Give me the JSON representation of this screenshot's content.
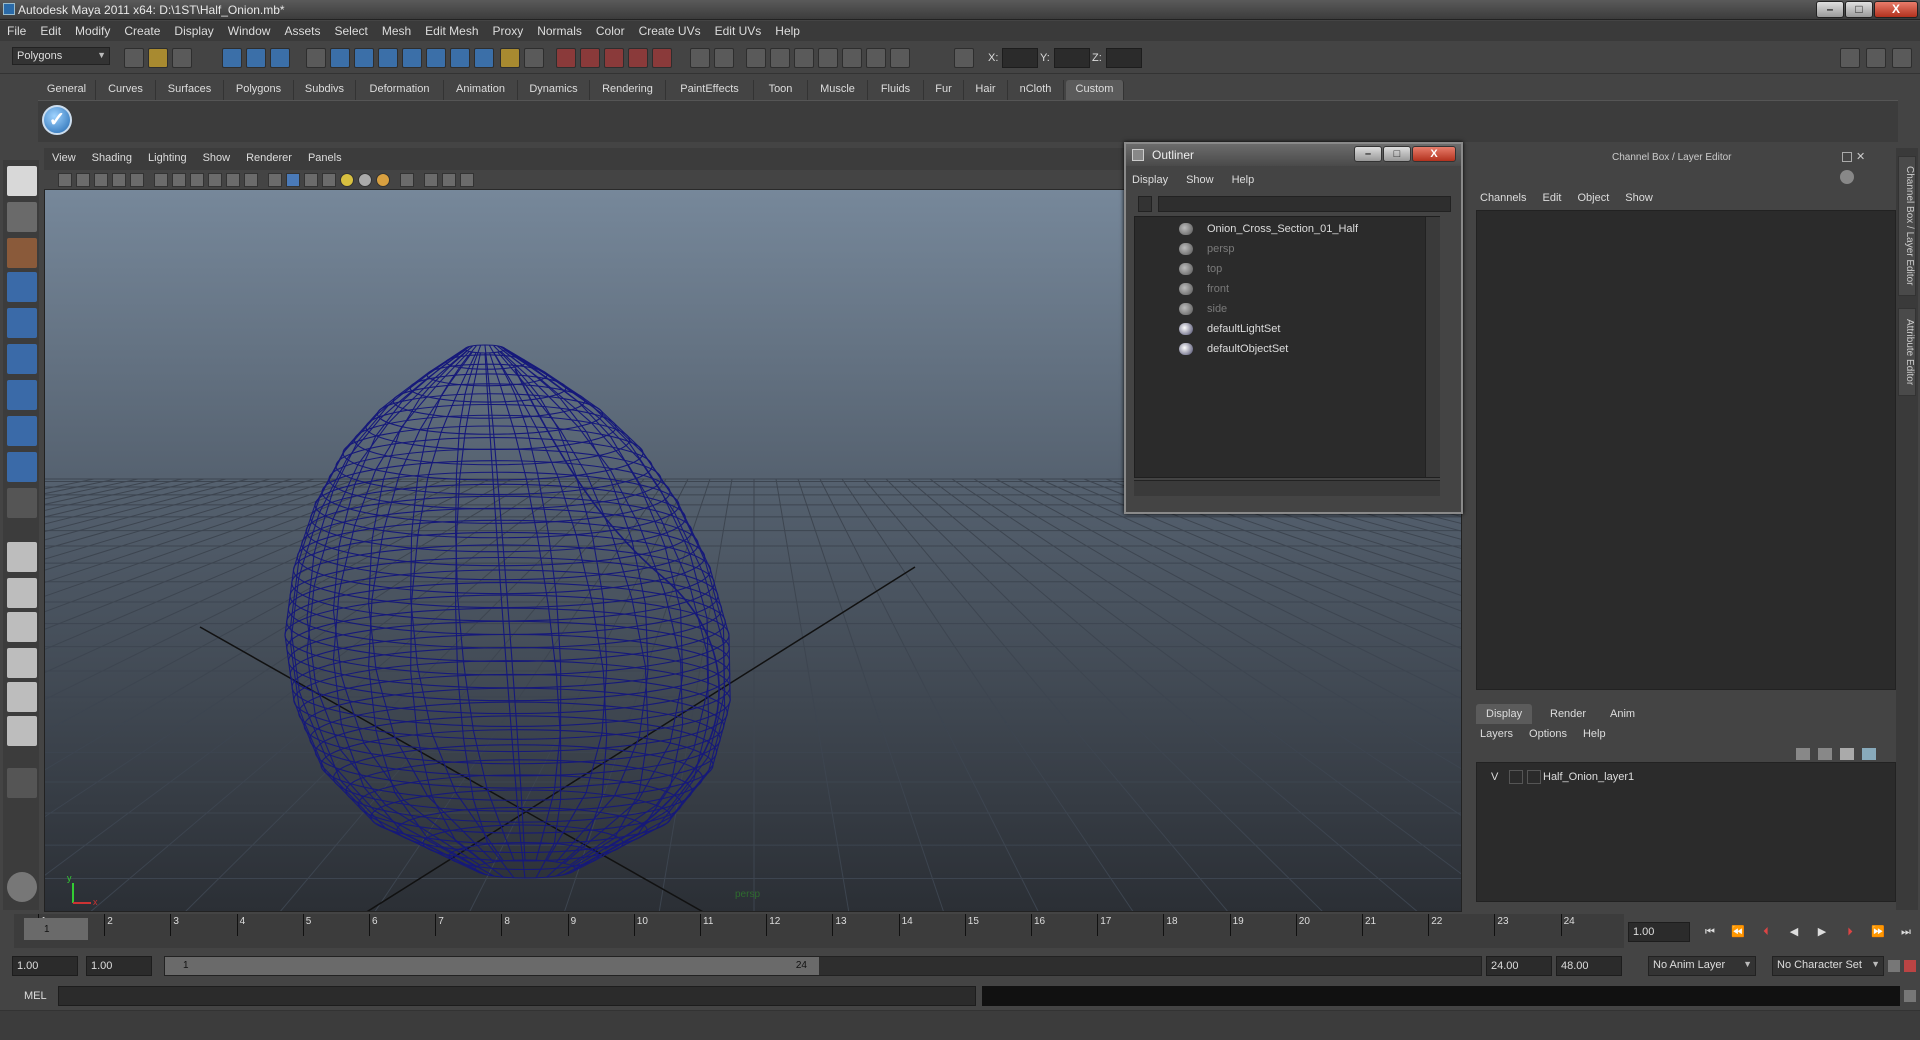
{
  "window": {
    "title": "Autodesk Maya 2011 x64: D:\\1ST\\Half_Onion.mb*",
    "minimize": "–",
    "maximize": "□",
    "close": "X"
  },
  "menubar": [
    "File",
    "Edit",
    "Modify",
    "Create",
    "Display",
    "Window",
    "Assets",
    "Select",
    "Mesh",
    "Edit Mesh",
    "Proxy",
    "Normals",
    "Color",
    "Create UVs",
    "Edit UVs",
    "Help"
  ],
  "statusline": {
    "mode": "Polygons",
    "x_label": "X:",
    "y_label": "Y:",
    "z_label": "Z:"
  },
  "shelf": {
    "tabs": [
      "General",
      "Curves",
      "Surfaces",
      "Polygons",
      "Subdivs",
      "Deformation",
      "Animation",
      "Dynamics",
      "Rendering",
      "PaintEffects",
      "Toon",
      "Muscle",
      "Fluids",
      "Fur",
      "Hair",
      "nCloth",
      "Custom"
    ],
    "active_tab": "Custom"
  },
  "viewport": {
    "menu": [
      "View",
      "Shading",
      "Lighting",
      "Show",
      "Renderer",
      "Panels"
    ],
    "camera_label": "persp",
    "axis_x": "x",
    "axis_y": "y",
    "wire_color": "#16197a"
  },
  "outliner": {
    "title": "Outliner",
    "menu": [
      "Display",
      "Show",
      "Help"
    ],
    "items": [
      {
        "label": "Onion_Cross_Section_01_Half",
        "dim": false
      },
      {
        "label": "persp",
        "dim": true
      },
      {
        "label": "top",
        "dim": true
      },
      {
        "label": "front",
        "dim": true
      },
      {
        "label": "side",
        "dim": true
      },
      {
        "label": "defaultLightSet",
        "dim": false
      },
      {
        "label": "defaultObjectSet",
        "dim": false
      }
    ]
  },
  "channelbox": {
    "title": "Channel Box / Layer Editor",
    "menu": [
      "Channels",
      "Edit",
      "Object",
      "Show"
    ],
    "layer_tabs": [
      "Display",
      "Render",
      "Anim"
    ],
    "active_layer_tab": "Display",
    "layer_menu": [
      "Layers",
      "Options",
      "Help"
    ],
    "layer": {
      "visibility": "V",
      "name": "Half_Onion_layer1"
    }
  },
  "sidetabs": [
    "Channel Box / Layer Editor",
    "Attribute Editor"
  ],
  "timeslider": {
    "ticks": [
      "1",
      "2",
      "3",
      "4",
      "5",
      "6",
      "7",
      "8",
      "9",
      "10",
      "11",
      "12",
      "13",
      "14",
      "15",
      "16",
      "17",
      "18",
      "19",
      "20",
      "21",
      "22",
      "23",
      "24"
    ],
    "current_frame_marker": "1",
    "current_time": "1.00"
  },
  "range": {
    "start": "1.00",
    "playback_start": "1.00",
    "range_start_label": "1",
    "range_end_label": "24",
    "playback_end": "24.00",
    "end": "48.00",
    "anim_layer": "No Anim Layer",
    "character_set": "No Character Set"
  },
  "cmdline": {
    "label": "MEL"
  }
}
